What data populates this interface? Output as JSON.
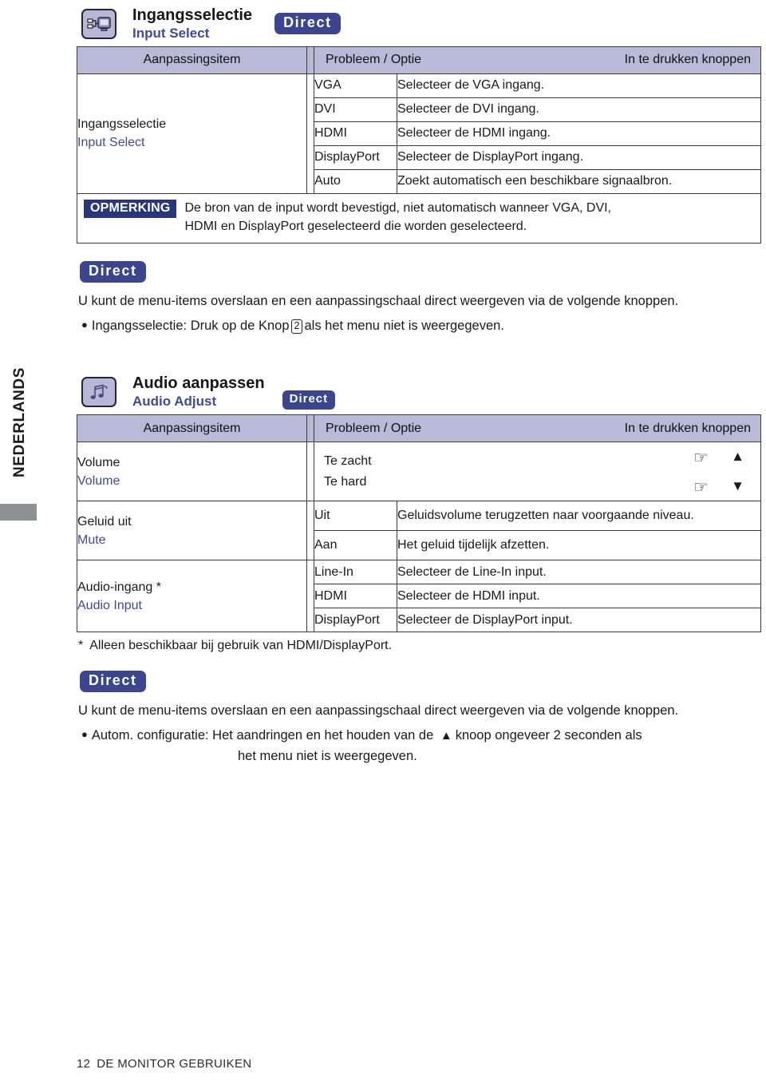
{
  "sidebar": {
    "language": "NEDERLANDS"
  },
  "footer": {
    "page_number": "12",
    "section": "DE MONITOR GEBRUIKEN"
  },
  "section1": {
    "icon": "input-connector-monitor-icon",
    "title_nl": "Ingangsselectie",
    "title_en": "Input Select",
    "badge": "Direct",
    "table": {
      "headers": {
        "item": "Aanpassingsitem",
        "option": "Probleem / Optie",
        "buttons": "In te drukken knoppen"
      },
      "item_nl": "Ingangsselectie",
      "item_en": "Input Select",
      "rows": [
        {
          "option": "VGA",
          "description": "Selecteer de VGA ingang."
        },
        {
          "option": "DVI",
          "description": "Selecteer de DVI ingang."
        },
        {
          "option": "HDMI",
          "description": "Selecteer de HDMI ingang."
        },
        {
          "option": "DisplayPort",
          "description": "Selecteer de DisplayPort ingang."
        },
        {
          "option": "Auto",
          "description": "Zoekt automatisch een beschikbare signaalbron."
        }
      ]
    },
    "note": {
      "tag": "OPMERKING",
      "line1": "De bron van de input wordt bevestigd, niet automatisch wanneer VGA, DVI,",
      "line2": "HDMI en DisplayPort geselecteerd die worden geselecteerd."
    },
    "direct": {
      "badge": "Direct",
      "paragraph": "U kunt de menu-items overslaan en een aanpassingschaal direct weergeven via de volgende knoppen.",
      "bullet_pre": "Ingangsselectie: Druk op de Knop",
      "bullet_key": "2",
      "bullet_post": "als het menu niet is weergegeven."
    }
  },
  "section2": {
    "icon": "music-notes-icon",
    "title_nl": "Audio aanpassen",
    "title_en": "Audio Adjust",
    "badge": "Direct",
    "table": {
      "headers": {
        "item": "Aanpassingsitem",
        "option": "Probleem / Optie",
        "buttons": "In te drukken knoppen"
      },
      "volume": {
        "item_nl": "Volume",
        "item_en": "Volume",
        "option1": "Te zacht",
        "option2": "Te hard",
        "btn_row1_hand": "hand-pointer-icon",
        "btn_row1_arrow": "triangle-up-icon",
        "btn_row2_hand": "hand-pointer-icon",
        "btn_row2_arrow": "triangle-down-icon"
      },
      "mute": {
        "item_nl": "Geluid uit",
        "item_en": "Mute",
        "rows": [
          {
            "option": "Uit",
            "description": "Geluidsvolume terugzetten naar voorgaande niveau."
          },
          {
            "option": "Aan",
            "description": "Het geluid tijdelijk afzetten."
          }
        ]
      },
      "audio_input": {
        "item_nl": "Audio-ingang *",
        "item_en": "Audio Input",
        "rows": [
          {
            "option": "Line-In",
            "description": "Selecteer de Line-In input."
          },
          {
            "option": "HDMI",
            "description": "Selecteer de HDMI input."
          },
          {
            "option": "DisplayPort",
            "description": "Selecteer de DisplayPort input."
          }
        ]
      }
    },
    "footnote_star": "*",
    "footnote": "Alleen beschikbaar bij gebruik van HDMI/DisplayPort.",
    "direct": {
      "badge": "Direct",
      "paragraph": "U kunt de menu-items overslaan en een aanpassingschaal direct weergeven via de volgende knoppen.",
      "bullet_pre": "Autom. configuratie: Het aandringen en het houden van de",
      "bullet_arrow": "triangle-up-icon",
      "bullet_post": "knoop ongeveer 2 seconden als",
      "bullet_line2": "het menu niet is weergegeven."
    }
  },
  "colors": {
    "accent_blue": "#3b4590",
    "header_lavender": "#b9b9d8",
    "english_label": "#3e4a9a",
    "note_tag": "#2a357f"
  }
}
